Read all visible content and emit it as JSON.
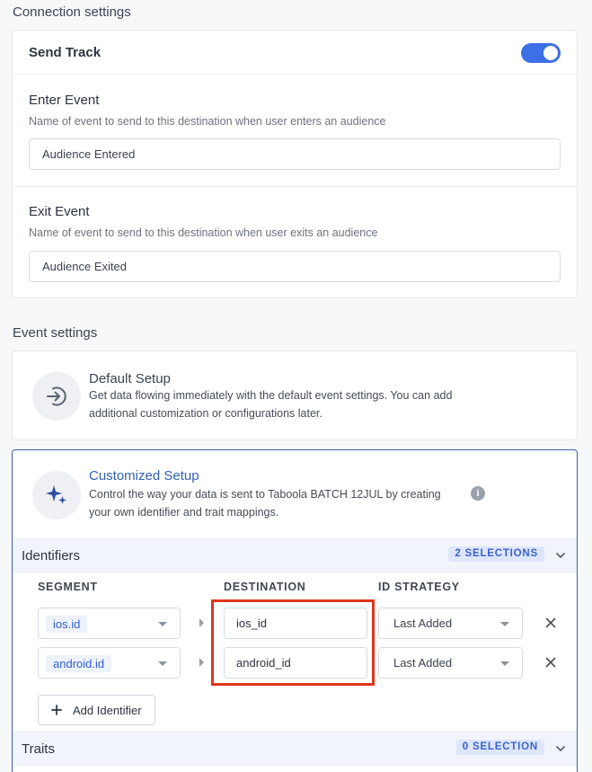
{
  "connection": {
    "section_title": "Connection settings",
    "send_track": {
      "label": "Send Track",
      "enabled": true
    },
    "enter_event": {
      "label": "Enter Event",
      "hint": "Name of event to send to this destination when user enters an audience",
      "value": "Audience Entered"
    },
    "exit_event": {
      "label": "Exit Event",
      "hint": "Name of event to send to this destination when user exits an audience",
      "value": "Audience Exited"
    }
  },
  "event_settings": {
    "section_title": "Event settings",
    "default_setup": {
      "title": "Default Setup",
      "description": "Get data flowing immediately with the default event settings. You can add additional customization or configurations later."
    },
    "customized_setup": {
      "title": "Customized Setup",
      "description": "Control the way your data is sent to Taboola BATCH 12JUL by creating your own identifier and trait mappings."
    },
    "identifiers": {
      "label": "Identifiers",
      "selections": "2 SELECTIONS",
      "columns": {
        "segment": "SEGMENT",
        "destination": "DESTINATION",
        "id_strategy": "ID STRATEGY"
      },
      "rows": [
        {
          "segment": "ios.id",
          "destination": "ios_id",
          "strategy": "Last Added"
        },
        {
          "segment": "android.id",
          "destination": "android_id",
          "strategy": "Last Added"
        }
      ],
      "add_label": "Add Identifier"
    },
    "traits": {
      "label": "Traits",
      "selections": "0 SELECTION"
    }
  },
  "colors": {
    "accent": "#3d6fe7",
    "highlight": "#e1351d",
    "title_blue": "#2f5fb0"
  },
  "icons": [
    "sign-in-icon",
    "sparkles-icon",
    "info-icon",
    "chevron-down-icon",
    "caret-down-icon",
    "close-icon",
    "plus-icon"
  ]
}
